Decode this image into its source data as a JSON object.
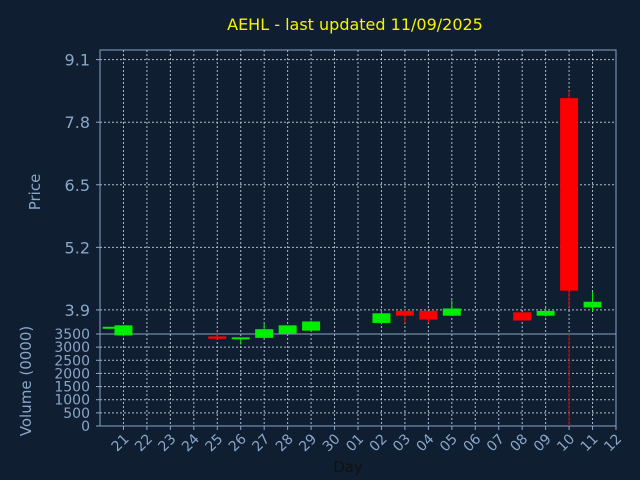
{
  "title": "AEHL - last updated 11/09/2025",
  "price_axis_label": "Price",
  "volume_axis_label": "Volume (0000)",
  "x_axis_label": "Day",
  "colors": {
    "background": "#0f1e30",
    "grid": "#b8c4d4",
    "axis": "#8aa6c8",
    "title": "#f5f500",
    "up": "#00ee00",
    "down": "#ff0000",
    "volume": "#cc0000"
  },
  "chart_data": {
    "type": "candlestick",
    "categories": [
      "21",
      "22",
      "23",
      "24",
      "25",
      "26",
      "27",
      "28",
      "29",
      "30",
      "01",
      "02",
      "03",
      "04",
      "05",
      "06",
      "07",
      "08",
      "09",
      "10",
      "11",
      "12"
    ],
    "price_ylim": [
      3.4,
      9.3
    ],
    "price_yticks": [
      "3.9",
      "5.2",
      "6.5",
      "7.8",
      "9.1"
    ],
    "volume_ylim": [
      0,
      3500
    ],
    "volume_yticks": [
      "0",
      "500",
      "1000",
      "1500",
      "2000",
      "2500",
      "3000",
      "3500"
    ],
    "candles": [
      {
        "x": 20.5,
        "open": 3.55,
        "high": 3.55,
        "low": 3.55,
        "close": 3.55
      },
      {
        "x": 21,
        "open": 3.37,
        "high": 3.58,
        "low": 3.35,
        "close": 3.58
      },
      {
        "x": 25,
        "open": 3.35,
        "high": 3.45,
        "low": 3.28,
        "close": 3.3
      },
      {
        "x": 26,
        "open": 3.32,
        "high": 3.32,
        "low": 3.18,
        "close": 3.33
      },
      {
        "x": 27,
        "open": 3.32,
        "high": 3.62,
        "low": 3.28,
        "close": 3.5
      },
      {
        "x": 28,
        "open": 3.4,
        "high": 3.58,
        "low": 3.38,
        "close": 3.58
      },
      {
        "x": 29,
        "open": 3.47,
        "high": 3.68,
        "low": 3.46,
        "close": 3.66
      },
      {
        "x": 32,
        "open": 3.63,
        "high": 3.9,
        "low": 3.6,
        "close": 3.83
      },
      {
        "x": 33,
        "open": 3.88,
        "high": 3.92,
        "low": 3.63,
        "close": 3.78
      },
      {
        "x": 34,
        "open": 3.88,
        "high": 3.88,
        "low": 3.63,
        "close": 3.7
      },
      {
        "x": 35,
        "open": 3.78,
        "high": 4.1,
        "low": 3.78,
        "close": 3.93
      },
      {
        "x": 38,
        "open": 3.85,
        "high": 3.85,
        "low": 3.68,
        "close": 3.68
      },
      {
        "x": 39,
        "open": 3.78,
        "high": 3.95,
        "low": 3.76,
        "close": 3.88
      },
      {
        "x": 40,
        "open": 8.3,
        "high": 8.45,
        "low": 3.95,
        "close": 4.3
      },
      {
        "x": 41,
        "open": 3.95,
        "high": 4.28,
        "low": 3.88,
        "close": 4.07
      }
    ],
    "volume": [
      {
        "x": 40,
        "value": 3500
      }
    ]
  }
}
